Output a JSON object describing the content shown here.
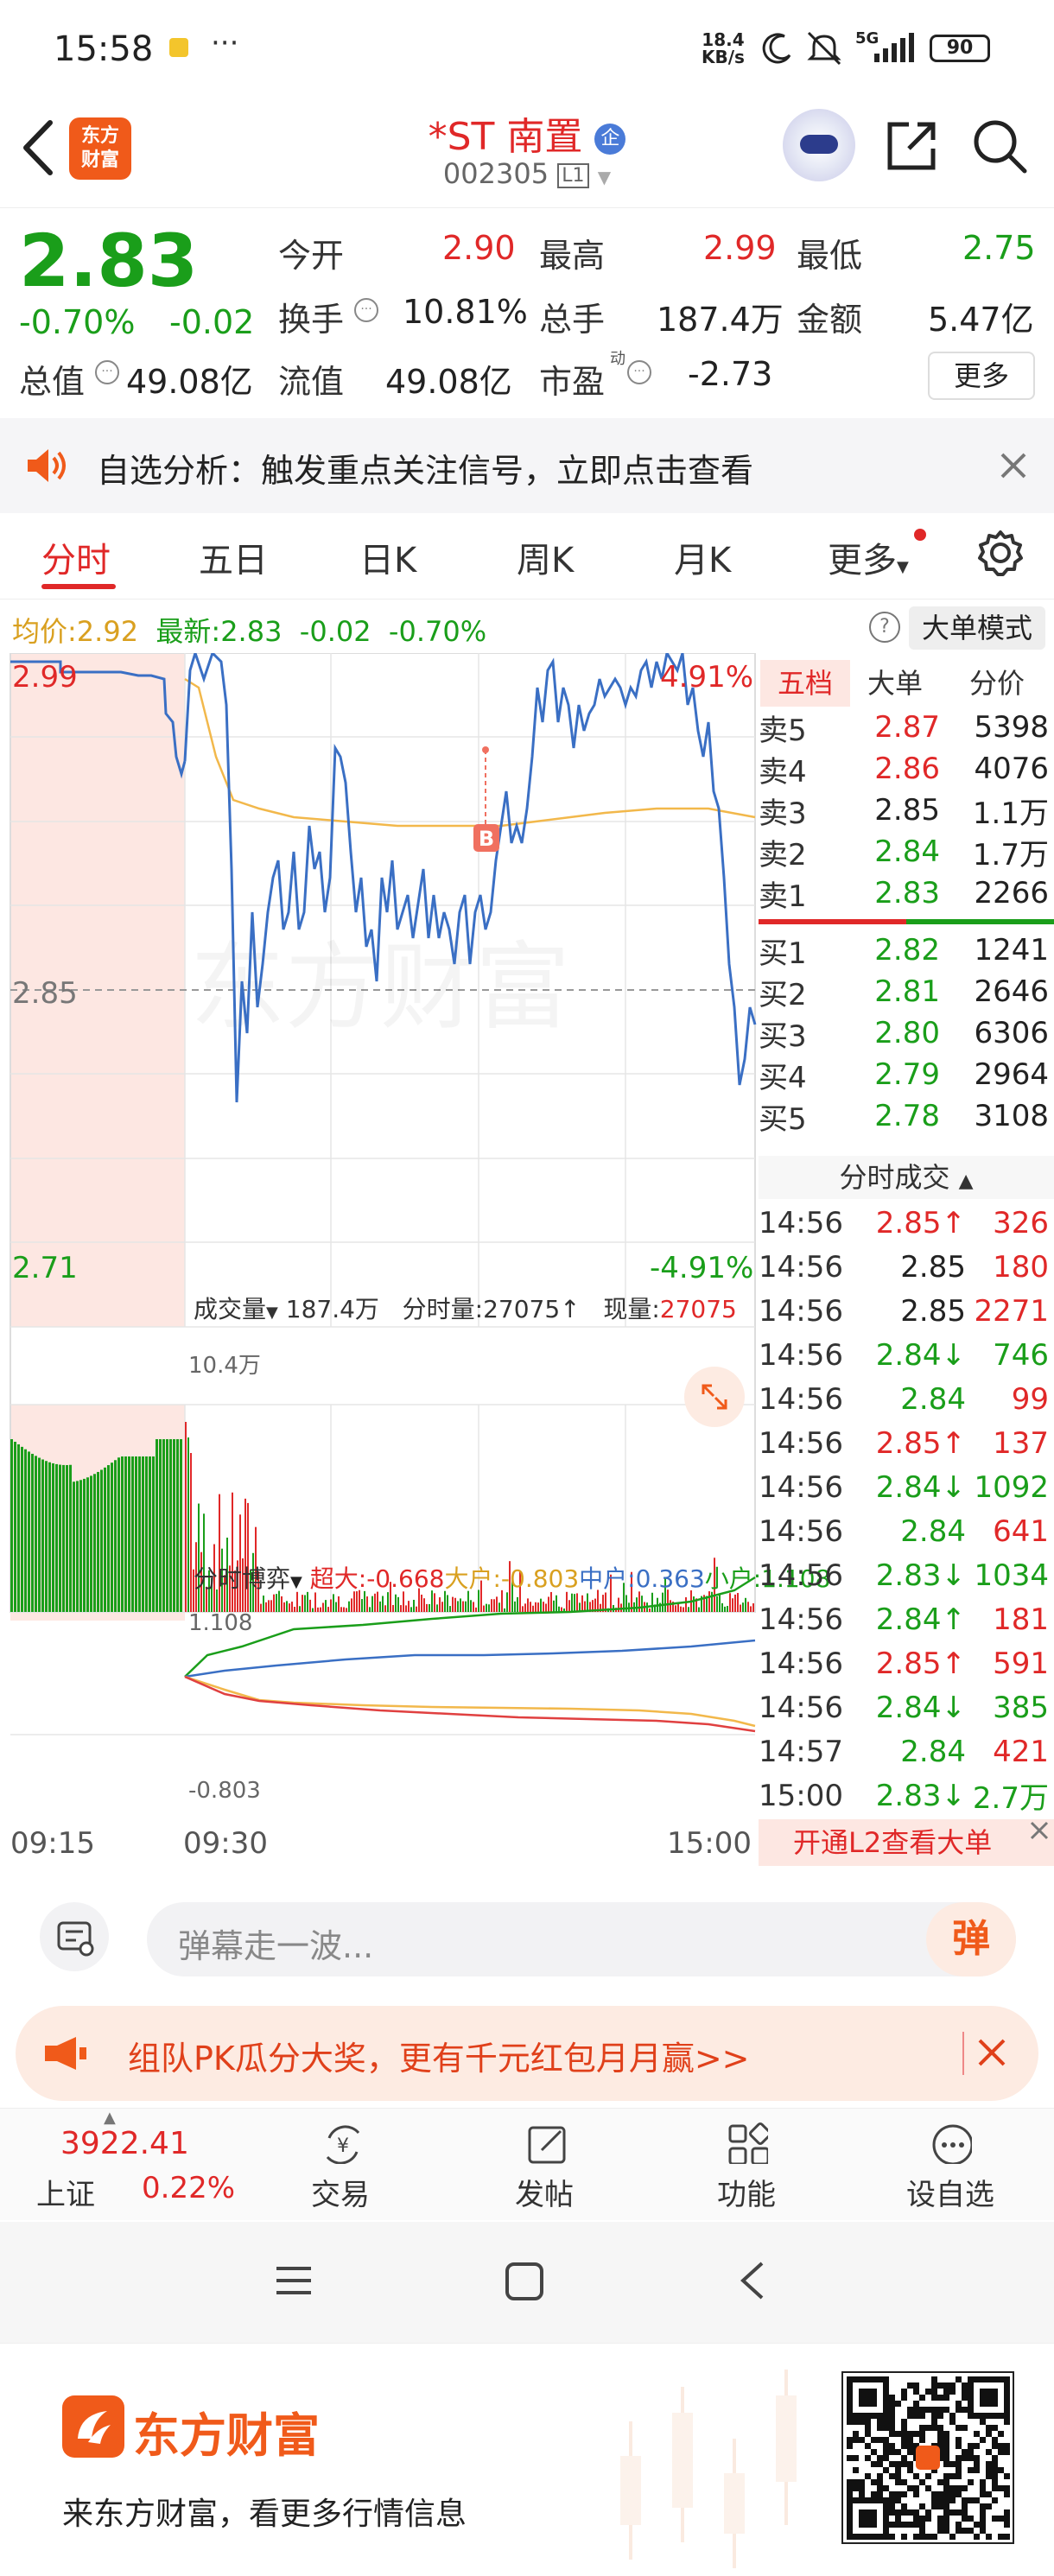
{
  "status_bar": {
    "time": "15:58",
    "more": "···",
    "net_speed_top": "18.4",
    "net_speed_bottom": "KB/s",
    "signal": "5G",
    "battery": "90"
  },
  "header": {
    "stock_name": "*ST 南置",
    "badge": "企",
    "stock_code": "002305",
    "level": "L1",
    "logo_line1": "东方",
    "logo_line2": "财富"
  },
  "quote": {
    "price": "2.83",
    "change_pct": "-0.70%",
    "change": "-0.02",
    "open_label": "今开",
    "open": "2.90",
    "high_label": "最高",
    "high": "2.99",
    "low_label": "最低",
    "low": "2.75",
    "turnover_label": "换手",
    "turnover": "10.81%",
    "volume_label": "总手",
    "volume": "187.4万",
    "amount_label": "金额",
    "amount": "5.47亿",
    "mktcap_label": "总值",
    "mktcap": "49.08亿",
    "float_label": "流值",
    "float": "49.08亿",
    "pe_label": "市盈",
    "pe_sup": "动",
    "pe": "-2.73",
    "more_btn": "更多"
  },
  "notice": {
    "text": "自选分析：触发重点关注信号，立即点击查看"
  },
  "tabs": [
    "分时",
    "五日",
    "日K",
    "周K",
    "月K",
    "更多"
  ],
  "chart_header": {
    "avg_label": "均价:",
    "avg": "2.92",
    "latest_label": "最新:",
    "latest": "2.83",
    "chg": "-0.02",
    "chg_pct": "-0.70%",
    "mode_btn": "大单模式"
  },
  "chart_labels": {
    "price_high": "2.99",
    "price_mid": "2.85",
    "price_low": "2.71",
    "pct_high": "4.91%",
    "pct_low": "-4.91%",
    "b_marker": "B",
    "watermark": "东方财富"
  },
  "volume_bar": {
    "label": "成交量",
    "total": "187.4万",
    "tick_label": "分时量:",
    "tick_vol": "27075",
    "cur_label": "现量:",
    "cur_vol": "27075",
    "max": "10.4万"
  },
  "game_bar": {
    "label": "分时博弈",
    "super": "超大:-0.668",
    "big": "大户:-0.803",
    "mid": "中户:0.363",
    "small": "小户:1.108",
    "max": "1.108",
    "min": "-0.803"
  },
  "time_axis": [
    "09:15",
    "09:30",
    "15:00"
  ],
  "orderbook_tabs": [
    "五档",
    "大单",
    "分价"
  ],
  "orderbook": {
    "asks": [
      {
        "label": "卖5",
        "price": "2.87",
        "vol": "5398",
        "color": "red"
      },
      {
        "label": "卖4",
        "price": "2.86",
        "vol": "4076",
        "color": "red"
      },
      {
        "label": "卖3",
        "price": "2.85",
        "vol": "1.1万",
        "color": "black"
      },
      {
        "label": "卖2",
        "price": "2.84",
        "vol": "1.7万",
        "color": "green"
      },
      {
        "label": "卖1",
        "price": "2.83",
        "vol": "2266",
        "color": "green"
      }
    ],
    "bids": [
      {
        "label": "买1",
        "price": "2.82",
        "vol": "1241",
        "color": "green"
      },
      {
        "label": "买2",
        "price": "2.81",
        "vol": "2646",
        "color": "green"
      },
      {
        "label": "买3",
        "price": "2.80",
        "vol": "6306",
        "color": "green"
      },
      {
        "label": "买4",
        "price": "2.79",
        "vol": "2964",
        "color": "green"
      },
      {
        "label": "买5",
        "price": "2.78",
        "vol": "3108",
        "color": "green"
      }
    ]
  },
  "ticks_title": "分时成交",
  "ticks": [
    {
      "t": "14:56",
      "p": "2.85",
      "pc": "red",
      "arrow": "↑",
      "v": "326",
      "vc": "red"
    },
    {
      "t": "14:56",
      "p": "2.85",
      "pc": "black",
      "arrow": "",
      "v": "180",
      "vc": "red"
    },
    {
      "t": "14:56",
      "p": "2.85",
      "pc": "black",
      "arrow": "",
      "v": "2271",
      "vc": "red"
    },
    {
      "t": "14:56",
      "p": "2.84",
      "pc": "green",
      "arrow": "↓",
      "v": "746",
      "vc": "green"
    },
    {
      "t": "14:56",
      "p": "2.84",
      "pc": "green",
      "arrow": "",
      "v": "99",
      "vc": "red"
    },
    {
      "t": "14:56",
      "p": "2.85",
      "pc": "red",
      "arrow": "↑",
      "v": "137",
      "vc": "red"
    },
    {
      "t": "14:56",
      "p": "2.84",
      "pc": "green",
      "arrow": "↓",
      "v": "1092",
      "vc": "green"
    },
    {
      "t": "14:56",
      "p": "2.84",
      "pc": "green",
      "arrow": "",
      "v": "641",
      "vc": "red"
    },
    {
      "t": "14:56",
      "p": "2.83",
      "pc": "green",
      "arrow": "↓",
      "v": "1034",
      "vc": "green"
    },
    {
      "t": "14:56",
      "p": "2.84",
      "pc": "green",
      "arrow": "↑",
      "v": "181",
      "vc": "red"
    },
    {
      "t": "14:56",
      "p": "2.85",
      "pc": "red",
      "arrow": "↑",
      "v": "591",
      "vc": "red"
    },
    {
      "t": "14:56",
      "p": "2.84",
      "pc": "green",
      "arrow": "↓",
      "v": "385",
      "vc": "green"
    },
    {
      "t": "14:57",
      "p": "2.84",
      "pc": "green",
      "arrow": "",
      "v": "421",
      "vc": "red"
    },
    {
      "t": "15:00",
      "p": "2.83",
      "pc": "green",
      "arrow": "↓",
      "v": "2.7万",
      "vc": "green"
    }
  ],
  "l2_banner": "开通L2查看大单",
  "comment": {
    "placeholder": "弹幕走一波...",
    "send": "弹"
  },
  "promo": {
    "text": "组队PK瓜分大奖，更有千元红包月月赢>>"
  },
  "bottom_nav": {
    "index_value": "3922.41",
    "index_name": "上证",
    "index_chg": "0.22%",
    "items": [
      "交易",
      "发帖",
      "功能",
      "设自选"
    ]
  },
  "footer": {
    "brand": "东方财富",
    "slogan": "来东方财富，看更多行情信息"
  },
  "colors": {
    "red": "#e02828",
    "green": "#1a9e1a",
    "blue": "#3a6fc4",
    "avg_line": "#f2b84b",
    "accent": "#f05a1a"
  }
}
